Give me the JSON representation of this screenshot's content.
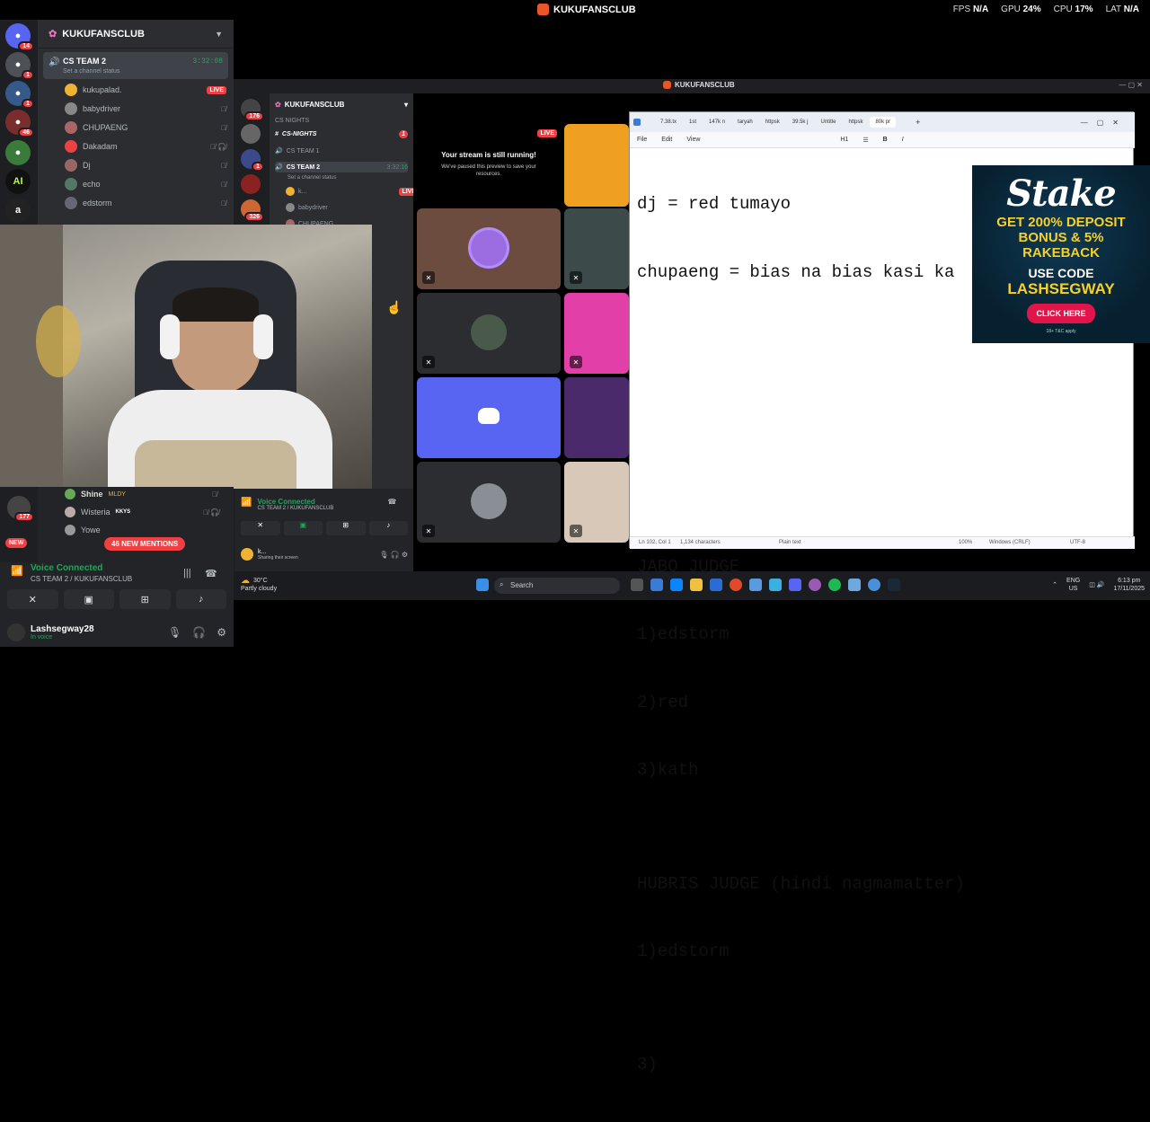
{
  "topbar": {
    "title": "KUKUFANSCLUB",
    "fps_label": "FPS",
    "fps_value": "N/A",
    "gpu_label": "GPU",
    "gpu_value": "24%",
    "cpu_label": "CPU",
    "cpu_value": "17%",
    "lat_label": "LAT",
    "lat_value": "N/A"
  },
  "server_rail": [
    {
      "letter": "",
      "badge": "14"
    },
    {
      "letter": "",
      "badge": "1"
    },
    {
      "letter": "",
      "badge": "1"
    },
    {
      "letter": "",
      "badge": "46"
    },
    {
      "letter": "",
      "badge": ""
    },
    {
      "letter": "AI",
      "badge": ""
    },
    {
      "letter": "a",
      "badge": ""
    }
  ],
  "guild": {
    "name": "KUKUFANSCLUB"
  },
  "voice_channel": {
    "name": "CS TEAM 2",
    "status": "Set a channel status",
    "timer": "3:32:08"
  },
  "members": [
    {
      "name": "kukupalad.",
      "live": "LIVE"
    },
    {
      "name": "babydriver"
    },
    {
      "name": "CHUPAENG"
    },
    {
      "name": "Dakadam"
    },
    {
      "name": "Dj"
    },
    {
      "name": "echo"
    },
    {
      "name": "edstorm"
    }
  ],
  "lower_members": [
    {
      "name": "Shine",
      "tag": "MLDY"
    },
    {
      "name": "Wisteria",
      "tag": "KKYS"
    },
    {
      "name": "Yowe",
      "tag": ""
    }
  ],
  "new_label": "NEW",
  "mentions": "46 NEW MENTIONS",
  "voice_connected": {
    "title": "Voice Connected",
    "sub": "CS TEAM 2 / KUKUFANSCLUB"
  },
  "user": {
    "name": "Lashsegway28",
    "status": "In voice"
  },
  "inner": {
    "title": "KUKUFANSCLUB",
    "guild": "KUKUFANSCLUB",
    "cat": "CS NIGHTS",
    "channel1": "CS-NIGHTS",
    "channel1_badge": "1",
    "team1": "CS TEAM 1",
    "team2": "CS TEAM 2",
    "team2_timer": "3:32:16",
    "team2_status": "Set a channel status",
    "m1": "k...",
    "m1_live": "LIVE",
    "m2": "babydriver",
    "m3": "CHUPAENG",
    "rail_badges": [
      "176",
      "1",
      "326"
    ],
    "stream_title": "Your stream is still running!",
    "stream_sub": "We've paused this preview to save your resources.",
    "stream_live": "LIVE",
    "voice_title": "Voice Connected",
    "voice_sub": "CS TEAM 2 / KUKUFANSCLUB",
    "user": "k...",
    "user_status": "Sharing their screen"
  },
  "notepad": {
    "tabs": [
      "7.38.tx",
      "1st",
      "147k n",
      "taryah",
      "httpsk",
      "39.5k j",
      "Untitle",
      "httpsk",
      "80k pr"
    ],
    "menu": [
      "File",
      "Edit",
      "View"
    ],
    "heading": "H1",
    "lines": [
      "dj = red tumayo",
      "chupaeng = bias na bias kasi ka",
      "",
      "",
      "",
      "",
      "",
      "JABO JUDGE",
      "1)edstorm",
      "2)red",
      "3)kath",
      "",
      "HUBRIS JUDGE (hindi nagmamatter)",
      "1)edstorm",
      "",
      "3)"
    ],
    "status": {
      "pos": "Ln 102, Col 1",
      "chars": "1,134 characters",
      "format": "Plain text",
      "zoom": "100%",
      "eol": "Windows (CRLF)",
      "enc": "UTF-8"
    }
  },
  "ad": {
    "logo": "Stake",
    "line1": "GET 200% DEPOSIT",
    "line2": "BONUS & 5%",
    "line3": "RAKEBACK",
    "code_label": "USE CODE",
    "code": "LASHSEGWAY",
    "cta": "CLICK HERE",
    "fine": "18+ T&C apply"
  },
  "taskbar": {
    "temp": "30°C",
    "weather": "Partly cloudy",
    "search": "Search",
    "lang1": "ENG",
    "lang2": "US",
    "time": "6:13 pm",
    "date": "17/11/2025"
  },
  "colors": {
    "discord_bg": "#2b2d31",
    "discord_rail": "#1e1f22",
    "live": "#ed4245",
    "voice_green": "#23a55a",
    "blurple": "#5865f2",
    "stake_yellow": "#f7d02c",
    "stake_pink": "#e1154a"
  }
}
